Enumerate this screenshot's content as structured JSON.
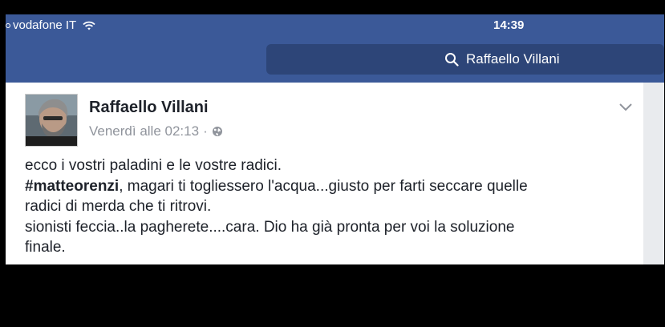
{
  "status_bar": {
    "carrier": "vodafone IT",
    "time": "14:39",
    "icons": [
      "signal-dot",
      "wifi-icon"
    ]
  },
  "search": {
    "value": "Raffaello Villani",
    "icon": "search-icon"
  },
  "post": {
    "author": "Raffaello Villani",
    "timestamp": "Venerdì alle 02:13",
    "separator": "·",
    "privacy_icon": "globe-icon",
    "menu_icon": "chevron-down-icon",
    "lines": [
      "ecco i vostri paladini e le vostre radici.",
      ", magari ti togliessero l'acqua...giusto per farti seccare quelle",
      "radici di merda che ti ritrovi.",
      "sionisti feccia..la pagherete....cara. Dio ha già pronta per voi la soluzione",
      "finale."
    ],
    "hashtag": "#matteorenzi"
  },
  "colors": {
    "header": "#3b5998",
    "search_bg": "#2d4578",
    "card_bg": "#ffffff",
    "text": "#1d2129",
    "meta": "#90949c"
  }
}
